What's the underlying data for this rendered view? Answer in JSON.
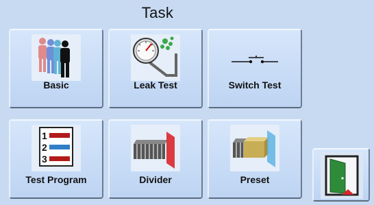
{
  "header": {
    "title": "Task"
  },
  "tasks": [
    {
      "label": "Basic",
      "icon": "people-icon"
    },
    {
      "label": "Leak Test",
      "icon": "pressure-gauge-icon"
    },
    {
      "label": "Switch Test",
      "icon": "switch-icon"
    },
    {
      "label": "Test Program",
      "icon": "numbered-list-icon"
    },
    {
      "label": "Divider",
      "icon": "divider-icon"
    },
    {
      "label": "Preset",
      "icon": "preset-icon"
    }
  ],
  "exit": {
    "icon": "exit-door-icon"
  }
}
